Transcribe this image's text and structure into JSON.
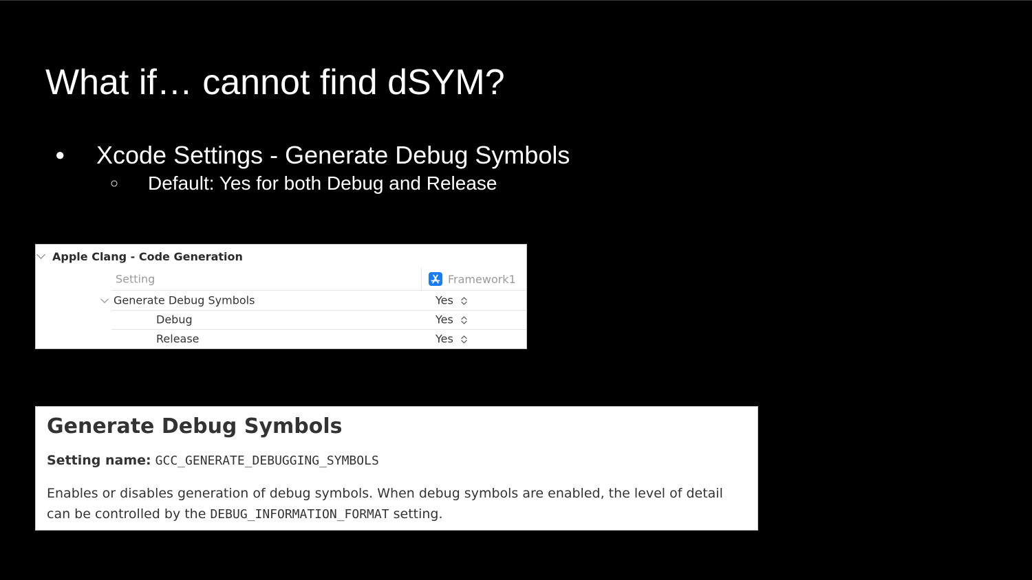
{
  "slide": {
    "title": "What if… cannot find dSYM?",
    "bullets": [
      {
        "glyph": "●",
        "text": "Xcode Settings - Generate Debug Symbols"
      },
      {
        "glyph": "○",
        "text": "Default: Yes for both Debug and Release"
      }
    ]
  },
  "xcode_settings": {
    "section_title": "Apple Clang - Code Generation",
    "column_setting": "Setting",
    "target_name": "Framework1",
    "rows": [
      {
        "name": "Generate Debug Symbols",
        "value": "Yes"
      },
      {
        "name": "Debug",
        "value": "Yes"
      },
      {
        "name": "Release",
        "value": "Yes"
      }
    ],
    "icons": {
      "target": "app-store-icon",
      "disclosure": "chevron-down-icon",
      "value": "stepper-arrows-icon"
    },
    "accent_color": "#1a7cf2"
  },
  "doc": {
    "title": "Generate Debug Symbols",
    "setting_label": "Setting name:",
    "setting_name": "GCC_GENERATE_DEBUGGING_SYMBOLS",
    "desc_part1": "Enables or disables generation of debug symbols. When debug symbols are enabled, the level of detail can be controlled by the",
    "desc_code": "DEBUG_INFORMATION_FORMAT",
    "desc_part2": "setting."
  }
}
